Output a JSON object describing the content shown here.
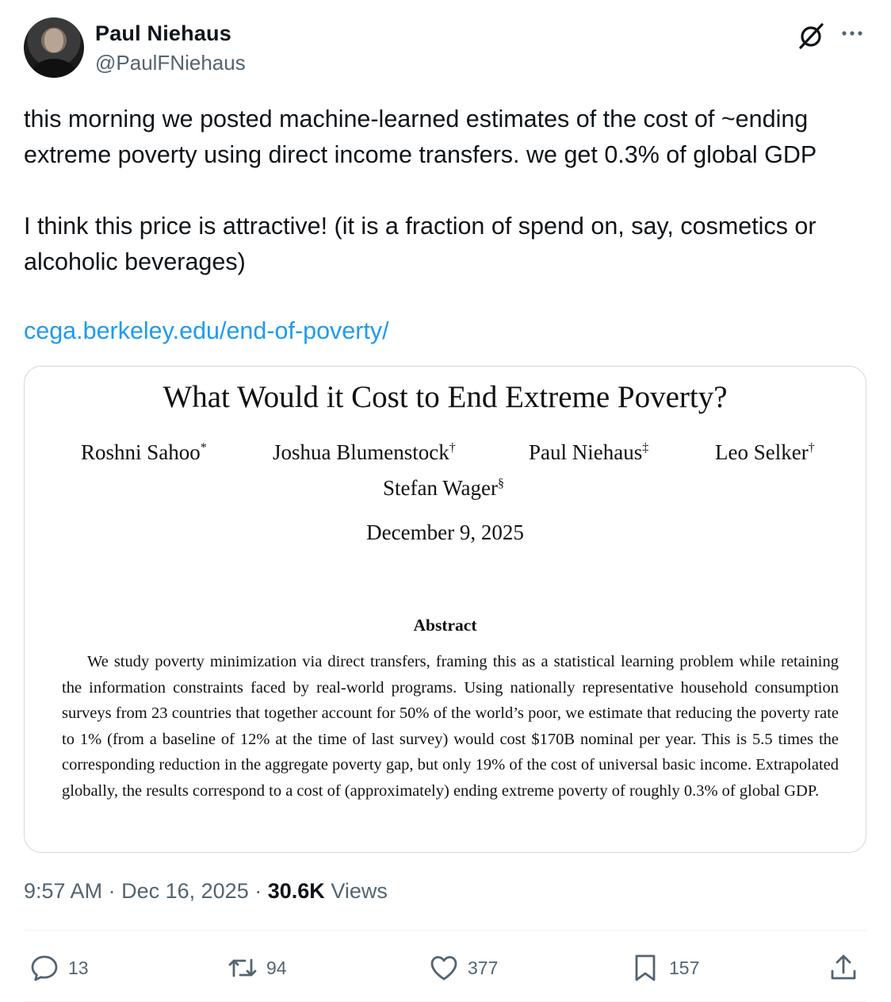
{
  "author": {
    "name": "Paul Niehaus",
    "handle": "@PaulFNiehaus"
  },
  "tweet": {
    "paragraph1": "this morning we posted machine-learned estimates of the cost of ~ending extreme poverty using direct income transfers. we get 0.3% of global GDP",
    "paragraph2": "I think this price is attractive! (it is a fraction of spend on, say, cosmetics or alcoholic beverages)",
    "link": "cega.berkeley.edu/end-of-poverty/"
  },
  "paper": {
    "title": "What Would it Cost to End Extreme Poverty?",
    "authors": [
      {
        "name": "Roshni Sahoo",
        "mark": "*"
      },
      {
        "name": "Joshua Blumenstock",
        "mark": "†"
      },
      {
        "name": "Paul Niehaus",
        "mark": "‡"
      },
      {
        "name": "Leo Selker",
        "mark": "†"
      },
      {
        "name": "Stefan Wager",
        "mark": "§"
      }
    ],
    "date": "December 9, 2025",
    "abstract_heading": "Abstract",
    "abstract": "We study poverty minimization via direct transfers, framing this as a statistical learning problem while retaining the information constraints faced by real-world programs. Using nationally representative household consumption surveys from 23 countries that together account for 50% of the world’s poor, we estimate that reducing the poverty rate to 1% (from a baseline of 12% at the time of last survey) would cost $170B nominal per year. This is 5.5 times the corresponding reduction in the aggregate poverty gap, but only 19% of the cost of universal basic income. Extrapolated globally, the results correspond to a cost of (approximately) ending extreme poverty of roughly 0.3% of global GDP."
  },
  "meta": {
    "time": "9:57 AM",
    "sep1": "·",
    "date": "Dec 16, 2025",
    "sep2": "·",
    "views_count": "30.6K",
    "views_label": "Views"
  },
  "actions": {
    "replies": "13",
    "reposts": "94",
    "likes": "377",
    "bookmarks": "157"
  },
  "icons": [
    "grok-icon",
    "more-icon",
    "reply-icon",
    "repost-icon",
    "like-icon",
    "bookmark-icon",
    "share-icon"
  ],
  "colors": {
    "link": "#1d9bf0",
    "secondary": "#536471",
    "text": "#0f1419",
    "border": "#cfd9de"
  }
}
